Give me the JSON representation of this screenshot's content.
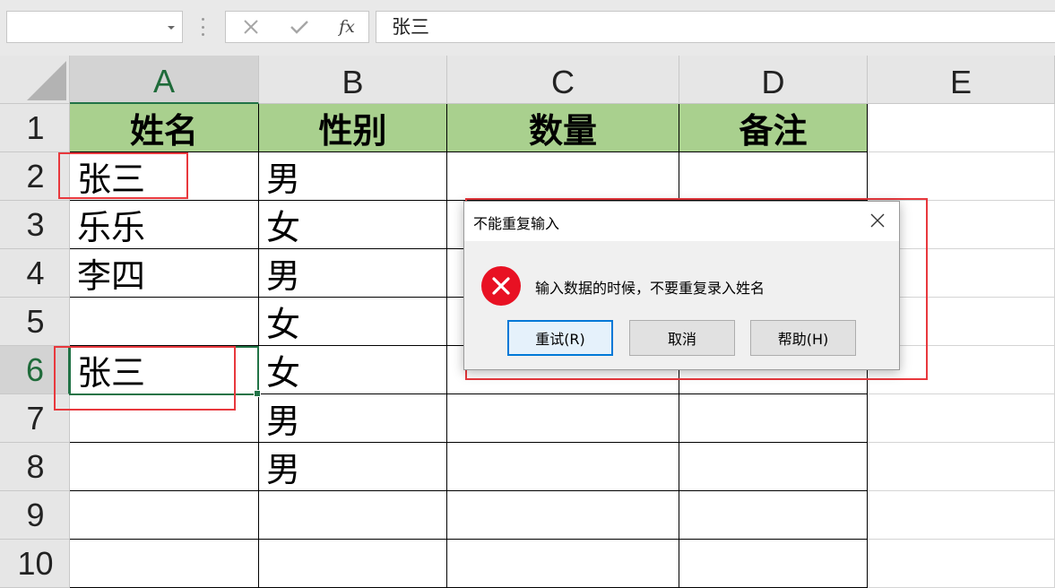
{
  "formula_bar": {
    "name_box": "",
    "formula": "张三",
    "cancel_icon": "close-icon",
    "enter_icon": "checkmark-icon",
    "function_icon": "fx-icon",
    "function_label": "fx"
  },
  "columns": [
    "A",
    "B",
    "C",
    "D",
    "E"
  ],
  "rows": [
    "1",
    "2",
    "3",
    "4",
    "5",
    "6",
    "7",
    "8",
    "9",
    "10"
  ],
  "active_cell": {
    "column": "A",
    "row": "6"
  },
  "cells": {
    "A1": "姓名",
    "B1": "性别",
    "C1": "数量",
    "D1": "备注",
    "A2": "张三",
    "B2": "男",
    "A3": "乐乐",
    "B3": "女",
    "A4": "李四",
    "B4": "男",
    "B5": "女",
    "A6": "张三",
    "B6": "女",
    "B7": "男",
    "B8": "男"
  },
  "colors": {
    "header_fill": "#a9d08e",
    "selection": "#217346",
    "annotation": "#e8383d",
    "error_icon": "#e81123"
  },
  "dialog": {
    "title": "不能重复输入",
    "message": "输入数据的时候，不要重复录入姓名",
    "icon": "error-icon",
    "buttons": {
      "retry": "重试(R)",
      "cancel": "取消",
      "help": "帮助(H)"
    }
  }
}
